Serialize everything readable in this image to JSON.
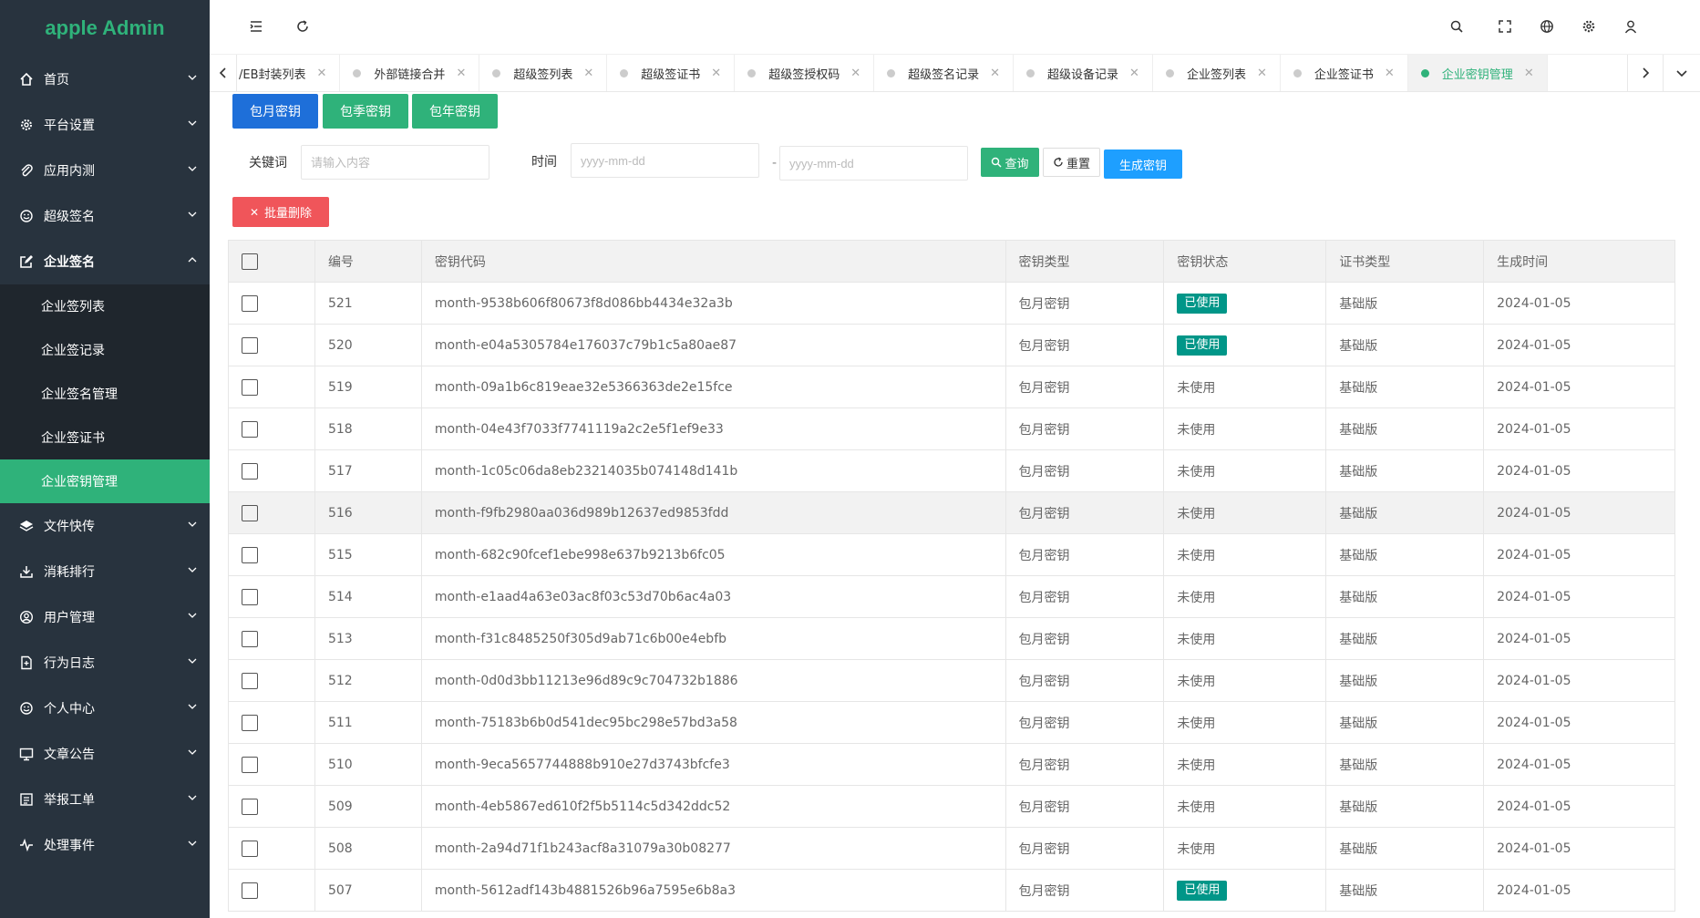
{
  "app": {
    "title": "apple Admin"
  },
  "sidebar": {
    "items": [
      {
        "label": "首页",
        "icon": "home-icon"
      },
      {
        "label": "平台设置",
        "icon": "gear-icon"
      },
      {
        "label": "应用内测",
        "icon": "paperclip-icon"
      },
      {
        "label": "超级签名",
        "icon": "smile-icon"
      },
      {
        "label": "企业签名",
        "icon": "edit-icon"
      },
      {
        "label": "文件快传",
        "icon": "layers-icon"
      },
      {
        "label": "消耗排行",
        "icon": "download-icon"
      },
      {
        "label": "用户管理",
        "icon": "user-circle-icon"
      },
      {
        "label": "行为日志",
        "icon": "file-icon"
      },
      {
        "label": "个人中心",
        "icon": "smile-icon"
      },
      {
        "label": "文章公告",
        "icon": "monitor-icon"
      },
      {
        "label": "举报工单",
        "icon": "list-icon"
      },
      {
        "label": "处理事件",
        "icon": "pulse-icon"
      }
    ],
    "submenu": [
      {
        "label": "企业签列表"
      },
      {
        "label": "企业签记录"
      },
      {
        "label": "企业签名管理"
      },
      {
        "label": "企业签证书"
      },
      {
        "label": "企业密钥管理"
      }
    ]
  },
  "tabs": [
    {
      "label": "/EB封装列表"
    },
    {
      "label": "外部链接合并"
    },
    {
      "label": "超级签列表"
    },
    {
      "label": "超级签证书"
    },
    {
      "label": "超级签授权码"
    },
    {
      "label": "超级签名记录"
    },
    {
      "label": "超级设备记录"
    },
    {
      "label": "企业签列表"
    },
    {
      "label": "企业签证书"
    },
    {
      "label": "企业密钥管理"
    }
  ],
  "toolbar": {
    "monthly": "包月密钥",
    "quarterly": "包季密钥",
    "yearly": "包年密钥",
    "keyword_label": "关键词",
    "keyword_placeholder": "请输入内容",
    "time_label": "时间",
    "date_placeholder": "yyyy-mm-dd",
    "date_sep": "-",
    "search": "查询",
    "reset": "重置",
    "generate": "生成密钥",
    "batch_delete": "批量删除"
  },
  "colors": {
    "sidebar_bg": "#28333e",
    "accent_green": "#2fb27a",
    "blue": "#1e6fd9",
    "teal": "#009688",
    "red": "#f0555a",
    "light_blue": "#1e9fff"
  },
  "table": {
    "headers": [
      "编号",
      "密钥代码",
      "密钥类型",
      "密钥状态",
      "证书类型",
      "生成时间"
    ],
    "rows": [
      {
        "id": "521",
        "code": "month-9538b606f80673f8d086bb4434e32a3b",
        "type": "包月密钥",
        "status": "已使用",
        "cert": "基础版",
        "date": "2024-01-05"
      },
      {
        "id": "520",
        "code": "month-e04a5305784e176037c79b1c5a80ae87",
        "type": "包月密钥",
        "status": "已使用",
        "cert": "基础版",
        "date": "2024-01-05"
      },
      {
        "id": "519",
        "code": "month-09a1b6c819eae32e5366363de2e15fce",
        "type": "包月密钥",
        "status": "未使用",
        "cert": "基础版",
        "date": "2024-01-05"
      },
      {
        "id": "518",
        "code": "month-04e43f7033f7741119a2c2e5f1ef9e33",
        "type": "包月密钥",
        "status": "未使用",
        "cert": "基础版",
        "date": "2024-01-05"
      },
      {
        "id": "517",
        "code": "month-1c05c06da8eb23214035b074148d141b",
        "type": "包月密钥",
        "status": "未使用",
        "cert": "基础版",
        "date": "2024-01-05"
      },
      {
        "id": "516",
        "code": "month-f9fb2980aa036d989b12637ed9853fdd",
        "type": "包月密钥",
        "status": "未使用",
        "cert": "基础版",
        "date": "2024-01-05"
      },
      {
        "id": "515",
        "code": "month-682c90fcef1ebe998e637b9213b6fc05",
        "type": "包月密钥",
        "status": "未使用",
        "cert": "基础版",
        "date": "2024-01-05"
      },
      {
        "id": "514",
        "code": "month-e1aad4a63e03ac8f03c53d70b6ac4a03",
        "type": "包月密钥",
        "status": "未使用",
        "cert": "基础版",
        "date": "2024-01-05"
      },
      {
        "id": "513",
        "code": "month-f31c8485250f305d9ab71c6b00e4ebfb",
        "type": "包月密钥",
        "status": "未使用",
        "cert": "基础版",
        "date": "2024-01-05"
      },
      {
        "id": "512",
        "code": "month-0d0d3bb11213e96d89c9c704732b1886",
        "type": "包月密钥",
        "status": "未使用",
        "cert": "基础版",
        "date": "2024-01-05"
      },
      {
        "id": "511",
        "code": "month-75183b6b0d541dec95bc298e57bd3a58",
        "type": "包月密钥",
        "status": "未使用",
        "cert": "基础版",
        "date": "2024-01-05"
      },
      {
        "id": "510",
        "code": "month-9eca5657744888b910e27d3743bfcfe3",
        "type": "包月密钥",
        "status": "未使用",
        "cert": "基础版",
        "date": "2024-01-05"
      },
      {
        "id": "509",
        "code": "month-4eb5867ed610f2f5b5114c5d342ddc52",
        "type": "包月密钥",
        "status": "未使用",
        "cert": "基础版",
        "date": "2024-01-05"
      },
      {
        "id": "508",
        "code": "month-2a94d71f1b243acf8a31079a30b08277",
        "type": "包月密钥",
        "status": "未使用",
        "cert": "基础版",
        "date": "2024-01-05"
      },
      {
        "id": "507",
        "code": "month-5612adf143b4881526b96a7595e6b8a3",
        "type": "包月密钥",
        "status": "已使用",
        "cert": "基础版",
        "date": "2024-01-05"
      }
    ]
  }
}
